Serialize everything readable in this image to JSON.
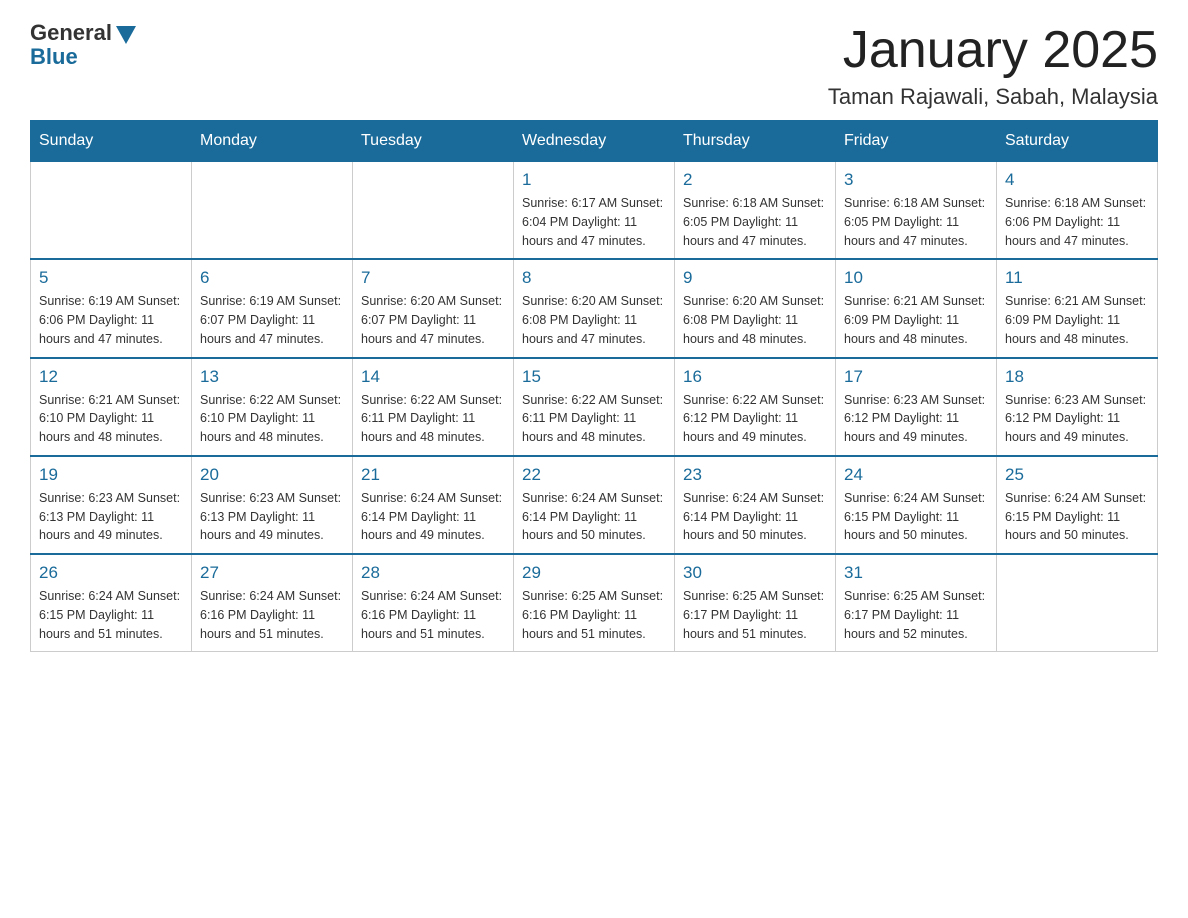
{
  "header": {
    "logo_general": "General",
    "logo_blue": "Blue",
    "month_title": "January 2025",
    "location": "Taman Rajawali, Sabah, Malaysia"
  },
  "weekdays": [
    "Sunday",
    "Monday",
    "Tuesday",
    "Wednesday",
    "Thursday",
    "Friday",
    "Saturday"
  ],
  "weeks": [
    [
      {
        "day": "",
        "info": ""
      },
      {
        "day": "",
        "info": ""
      },
      {
        "day": "",
        "info": ""
      },
      {
        "day": "1",
        "info": "Sunrise: 6:17 AM\nSunset: 6:04 PM\nDaylight: 11 hours\nand 47 minutes."
      },
      {
        "day": "2",
        "info": "Sunrise: 6:18 AM\nSunset: 6:05 PM\nDaylight: 11 hours\nand 47 minutes."
      },
      {
        "day": "3",
        "info": "Sunrise: 6:18 AM\nSunset: 6:05 PM\nDaylight: 11 hours\nand 47 minutes."
      },
      {
        "day": "4",
        "info": "Sunrise: 6:18 AM\nSunset: 6:06 PM\nDaylight: 11 hours\nand 47 minutes."
      }
    ],
    [
      {
        "day": "5",
        "info": "Sunrise: 6:19 AM\nSunset: 6:06 PM\nDaylight: 11 hours\nand 47 minutes."
      },
      {
        "day": "6",
        "info": "Sunrise: 6:19 AM\nSunset: 6:07 PM\nDaylight: 11 hours\nand 47 minutes."
      },
      {
        "day": "7",
        "info": "Sunrise: 6:20 AM\nSunset: 6:07 PM\nDaylight: 11 hours\nand 47 minutes."
      },
      {
        "day": "8",
        "info": "Sunrise: 6:20 AM\nSunset: 6:08 PM\nDaylight: 11 hours\nand 47 minutes."
      },
      {
        "day": "9",
        "info": "Sunrise: 6:20 AM\nSunset: 6:08 PM\nDaylight: 11 hours\nand 48 minutes."
      },
      {
        "day": "10",
        "info": "Sunrise: 6:21 AM\nSunset: 6:09 PM\nDaylight: 11 hours\nand 48 minutes."
      },
      {
        "day": "11",
        "info": "Sunrise: 6:21 AM\nSunset: 6:09 PM\nDaylight: 11 hours\nand 48 minutes."
      }
    ],
    [
      {
        "day": "12",
        "info": "Sunrise: 6:21 AM\nSunset: 6:10 PM\nDaylight: 11 hours\nand 48 minutes."
      },
      {
        "day": "13",
        "info": "Sunrise: 6:22 AM\nSunset: 6:10 PM\nDaylight: 11 hours\nand 48 minutes."
      },
      {
        "day": "14",
        "info": "Sunrise: 6:22 AM\nSunset: 6:11 PM\nDaylight: 11 hours\nand 48 minutes."
      },
      {
        "day": "15",
        "info": "Sunrise: 6:22 AM\nSunset: 6:11 PM\nDaylight: 11 hours\nand 48 minutes."
      },
      {
        "day": "16",
        "info": "Sunrise: 6:22 AM\nSunset: 6:12 PM\nDaylight: 11 hours\nand 49 minutes."
      },
      {
        "day": "17",
        "info": "Sunrise: 6:23 AM\nSunset: 6:12 PM\nDaylight: 11 hours\nand 49 minutes."
      },
      {
        "day": "18",
        "info": "Sunrise: 6:23 AM\nSunset: 6:12 PM\nDaylight: 11 hours\nand 49 minutes."
      }
    ],
    [
      {
        "day": "19",
        "info": "Sunrise: 6:23 AM\nSunset: 6:13 PM\nDaylight: 11 hours\nand 49 minutes."
      },
      {
        "day": "20",
        "info": "Sunrise: 6:23 AM\nSunset: 6:13 PM\nDaylight: 11 hours\nand 49 minutes."
      },
      {
        "day": "21",
        "info": "Sunrise: 6:24 AM\nSunset: 6:14 PM\nDaylight: 11 hours\nand 49 minutes."
      },
      {
        "day": "22",
        "info": "Sunrise: 6:24 AM\nSunset: 6:14 PM\nDaylight: 11 hours\nand 50 minutes."
      },
      {
        "day": "23",
        "info": "Sunrise: 6:24 AM\nSunset: 6:14 PM\nDaylight: 11 hours\nand 50 minutes."
      },
      {
        "day": "24",
        "info": "Sunrise: 6:24 AM\nSunset: 6:15 PM\nDaylight: 11 hours\nand 50 minutes."
      },
      {
        "day": "25",
        "info": "Sunrise: 6:24 AM\nSunset: 6:15 PM\nDaylight: 11 hours\nand 50 minutes."
      }
    ],
    [
      {
        "day": "26",
        "info": "Sunrise: 6:24 AM\nSunset: 6:15 PM\nDaylight: 11 hours\nand 51 minutes."
      },
      {
        "day": "27",
        "info": "Sunrise: 6:24 AM\nSunset: 6:16 PM\nDaylight: 11 hours\nand 51 minutes."
      },
      {
        "day": "28",
        "info": "Sunrise: 6:24 AM\nSunset: 6:16 PM\nDaylight: 11 hours\nand 51 minutes."
      },
      {
        "day": "29",
        "info": "Sunrise: 6:25 AM\nSunset: 6:16 PM\nDaylight: 11 hours\nand 51 minutes."
      },
      {
        "day": "30",
        "info": "Sunrise: 6:25 AM\nSunset: 6:17 PM\nDaylight: 11 hours\nand 51 minutes."
      },
      {
        "day": "31",
        "info": "Sunrise: 6:25 AM\nSunset: 6:17 PM\nDaylight: 11 hours\nand 52 minutes."
      },
      {
        "day": "",
        "info": ""
      }
    ]
  ]
}
